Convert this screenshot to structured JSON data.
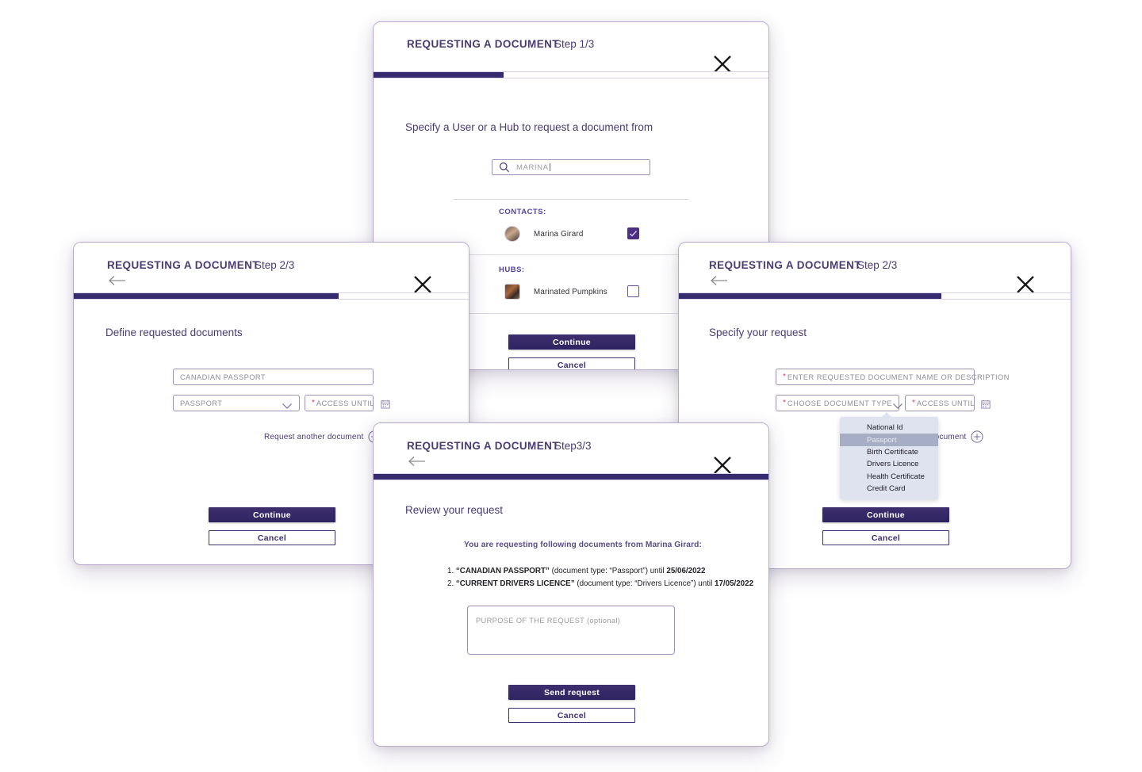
{
  "theme": {
    "accent": "#342c6e",
    "title_color": "#4a3b73",
    "border": "#b9a9cf",
    "required_star": "#e8336d",
    "dropdown_bg": "#dfe3ef",
    "dropdown_selected_bg": "#a5aec4"
  },
  "step1": {
    "title": "REQUESTING A DOCUMENT",
    "step_label": "Step 1/3",
    "close_label": "close-icon",
    "progress_percent": 33,
    "heading": "Specify a User or a Hub to request a document from",
    "search": {
      "value": "MARINA",
      "icon": "search-icon"
    },
    "contacts_label": "CONTACTS:",
    "contacts": [
      {
        "name": "Marina Girard",
        "checked": true
      }
    ],
    "hubs_label": "HUBS:",
    "hubs": [
      {
        "name": "Marinated Pumpkins",
        "checked": false
      }
    ],
    "continue_label": "Continue",
    "cancel_label": "Cancel"
  },
  "step2_left": {
    "title": "REQUESTING A DOCUMENT",
    "step_label": "Step 2/3",
    "progress_percent": 67,
    "heading": "Define requested documents",
    "document_name_value": "CANADIAN PASSPORT",
    "document_type_value": "PASSPORT",
    "access_until_label": "ACCESS UNTIL",
    "add_another_label": "Request another document",
    "continue_label": "Continue",
    "cancel_label": "Cancel"
  },
  "step2_right": {
    "title": "REQUESTING A DOCUMENT",
    "step_label": "Step 2/3",
    "progress_percent": 67,
    "heading": "Specify your request",
    "document_name_placeholder": "ENTER REQUESTED DOCUMENT NAME OR DESCRIPTION",
    "document_type_placeholder": "CHOOSE DOCUMENT TYPE",
    "access_until_label": "ACCESS UNTIL",
    "add_another_label": "Request another document",
    "dropdown_options": [
      "National Id",
      "Passport",
      "Birth Certificate",
      "Drivers Licence",
      "Health Certificate",
      "Credit Card"
    ],
    "dropdown_selected": "Passport",
    "continue_label": "Continue",
    "cancel_label": "Cancel"
  },
  "step3": {
    "title": "REQUESTING A DOCUMENT",
    "step_label": "Step3/3",
    "progress_percent": 100,
    "heading": "Review your request",
    "lead": "You are requesting following documents from Marina Girard:",
    "items": [
      {
        "index": "1.",
        "name": "“CANADIAN PASSPORT”",
        "middle": " (document type: “Passport”) until ",
        "date": "25/06/2022"
      },
      {
        "index": "2.",
        "name": "“CURRENT DRIVERS LICENCE”",
        "middle": " (document type: “Drivers Licence”) until ",
        "date": "17/05/2022"
      }
    ],
    "purpose_placeholder": "PURPOSE OF THE REQUEST (optional)",
    "send_label": "Send request",
    "cancel_label": "Cancel"
  }
}
